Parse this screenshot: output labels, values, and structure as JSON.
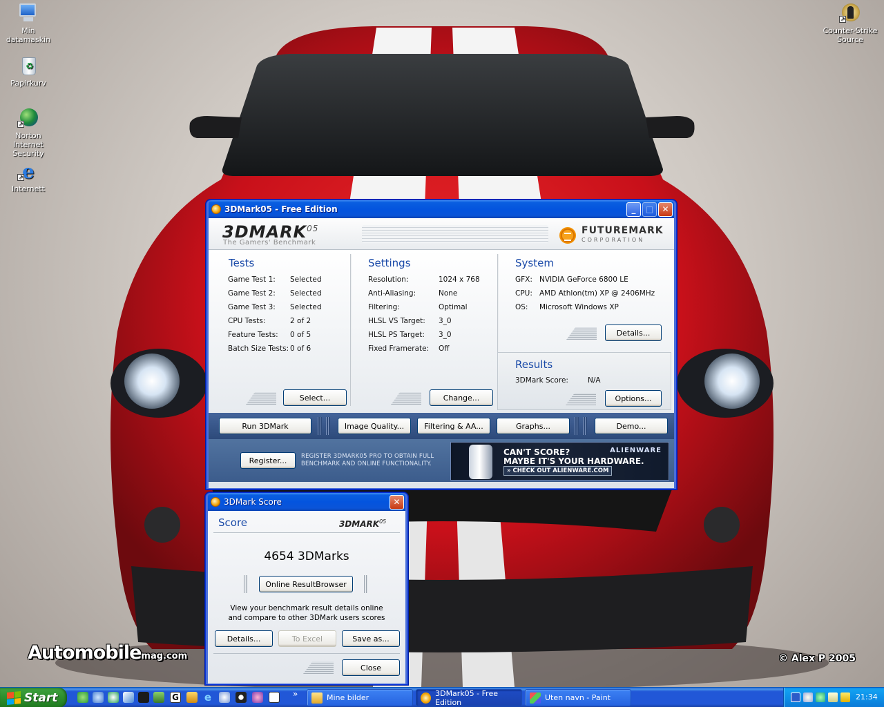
{
  "desktop": {
    "icons": [
      {
        "label": "Min datamaskin"
      },
      {
        "label": "Papirkurv"
      },
      {
        "label": "Norton Internet Security"
      },
      {
        "label": "Internett"
      },
      {
        "label": "Counter-Strike Source"
      }
    ],
    "wallpaper_watermark_left": "Automobile",
    "wallpaper_watermark_left_suffix": "mag.com",
    "wallpaper_watermark_right": "© Alex P 2005"
  },
  "main_window": {
    "title": "3DMark05 - Free Edition",
    "logo": "3DMARK",
    "logo_sup": "05",
    "tagline": "The Gamers' Benchmark",
    "brand": "FUTUREMARK",
    "brand_sub": "CORPORATION",
    "tests": {
      "heading": "Tests",
      "rows": [
        {
          "key": "Game Test 1:",
          "value": "Selected"
        },
        {
          "key": "Game Test 2:",
          "value": "Selected"
        },
        {
          "key": "Game Test 3:",
          "value": "Selected"
        },
        {
          "key": "CPU Tests:",
          "value": "2 of 2"
        },
        {
          "key": "Feature Tests:",
          "value": "0 of 5"
        },
        {
          "key": "Batch Size Tests:",
          "value": "0 of 6"
        }
      ],
      "button": "Select..."
    },
    "settings": {
      "heading": "Settings",
      "rows": [
        {
          "key": "Resolution:",
          "value": "1024 x 768"
        },
        {
          "key": "Anti-Aliasing:",
          "value": "None"
        },
        {
          "key": "Filtering:",
          "value": "Optimal"
        },
        {
          "key": "HLSL VS Target:",
          "value": "3_0"
        },
        {
          "key": "HLSL PS Target:",
          "value": "3_0"
        },
        {
          "key": "Fixed Framerate:",
          "value": "Off"
        }
      ],
      "button": "Change..."
    },
    "system": {
      "heading": "System",
      "rows": [
        {
          "key": "GFX:",
          "value": "NVIDIA GeForce 6800 LE"
        },
        {
          "key": "CPU:",
          "value": "AMD Athlon(tm) XP @ 2406MHz"
        },
        {
          "key": "OS:",
          "value": "Microsoft Windows XP"
        }
      ],
      "button": "Details..."
    },
    "results": {
      "heading": "Results",
      "key": "3DMark Score:",
      "value": "N/A",
      "button": "Options..."
    },
    "toolbar": {
      "run": "Run 3DMark",
      "image_quality": "Image Quality...",
      "filtering": "Filtering & AA...",
      "graphs": "Graphs...",
      "demo": "Demo..."
    },
    "register": {
      "button": "Register...",
      "text_line1": "REGISTER 3DMARK05 PRO TO OBTAIN FULL",
      "text_line2": "BENCHMARK AND ONLINE FUNCTIONALITY."
    },
    "ad": {
      "line1": "CAN'T SCORE?",
      "line2": "MAYBE IT'S YOUR HARDWARE.",
      "cta": "» CHECK OUT ALIENWARE.COM",
      "brand": "ALIENWARE"
    }
  },
  "score_window": {
    "title": "3DMark Score",
    "heading": "Score",
    "logo": "3DMARK",
    "logo_sup": "05",
    "score": "4654 3DMarks",
    "online_button": "Online ResultBrowser",
    "desc_line1": "View your benchmark result details online",
    "desc_line2": "and compare to other 3DMark users scores",
    "details_button": "Details...",
    "excel_button": "To Excel",
    "save_button": "Save as...",
    "close_button": "Close"
  },
  "taskbar": {
    "start": "Start",
    "tasks": [
      {
        "label": "Mine bilder"
      },
      {
        "label": "3DMark05 - Free Edition"
      },
      {
        "label": "Uten navn - Paint"
      }
    ],
    "overflow": "»",
    "clock": "21:34"
  },
  "colors": {
    "xp_blue": "#0454de",
    "heading_blue": "#1a4aa8",
    "car_red": "#d0121b",
    "start_green": "#2d8e2d"
  }
}
